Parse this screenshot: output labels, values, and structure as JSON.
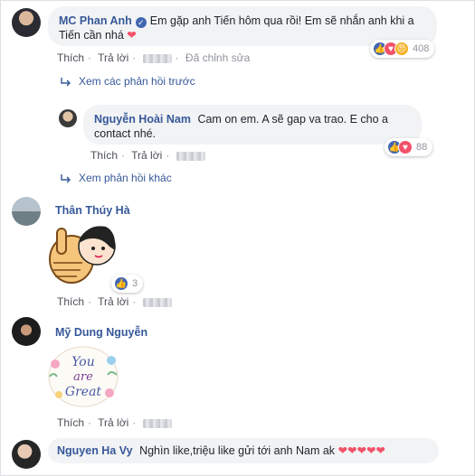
{
  "comments": [
    {
      "author": "MC Phan Anh",
      "verified": true,
      "text": "Em gặp anh Tiến hôm qua rồi! Em sẽ nhắn anh khi a Tiến cần nhá",
      "like_label": "Thích",
      "reply_label": "Trả lời",
      "edited_label": "Đã chỉnh sửa",
      "reaction_count": "408",
      "reaction_types": [
        "like",
        "love",
        "angry"
      ],
      "view_previous_replies": "Xem các phản hồi trước"
    },
    {
      "author": "Nguyễn Hoài Nam",
      "text": "Cam on em. A sẽ gap va trao. E cho a contact nhé.",
      "like_label": "Thích",
      "reply_label": "Trả lời",
      "reaction_count": "88",
      "reaction_types": [
        "like",
        "love"
      ],
      "view_more_replies": "Xem phản hồi khác"
    },
    {
      "author": "Thân Thúy Hà",
      "sticker": "thumbs-up-girl-sticker",
      "like_label": "Thích",
      "reply_label": "Trả lời",
      "reaction_count": "3",
      "reaction_types": [
        "like"
      ]
    },
    {
      "author": "Mỹ Dung Nguyễn",
      "sticker": "you-are-great-sticker",
      "sticker_text": [
        "You",
        "are",
        "Great"
      ],
      "like_label": "Thích",
      "reply_label": "Trả lời"
    },
    {
      "author": "Nguyen Ha Vy",
      "text": "Nghìn like,triệu like gửi tới anh Nam ak"
    }
  ],
  "colors": {
    "link": "#365899",
    "bubble": "#f2f3f5",
    "meta": "#90949c",
    "like": "#4267b2",
    "love": "#f25268",
    "angry": "#f7b125"
  }
}
